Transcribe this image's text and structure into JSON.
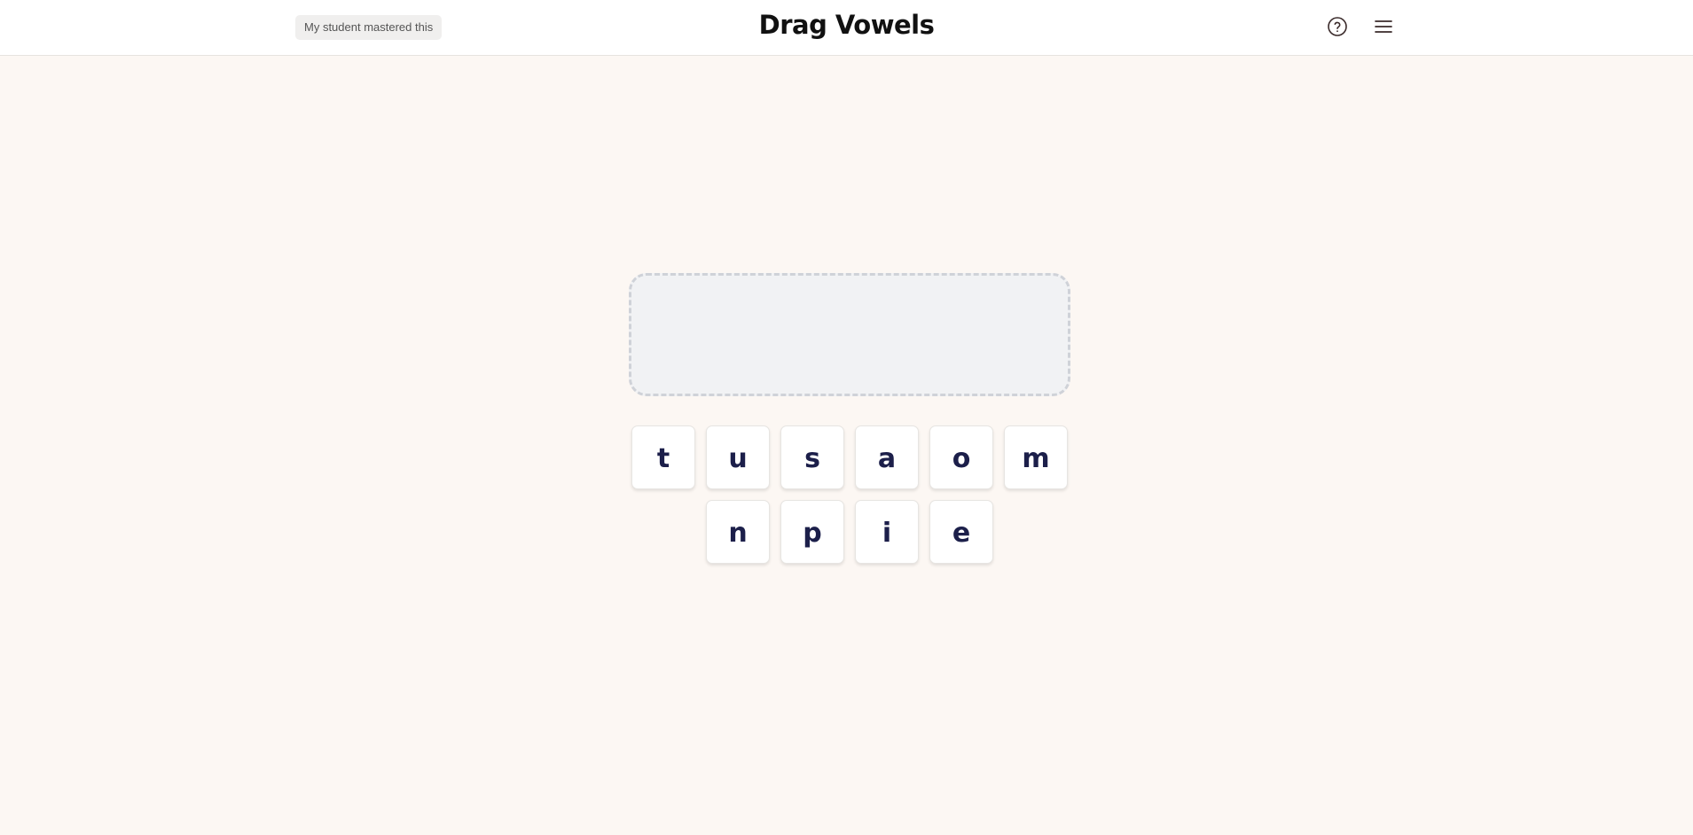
{
  "header": {
    "mastered_label": "My student mastered this",
    "title": "Drag Vowels",
    "help_icon": "help-circle-icon",
    "menu_icon": "hamburger-menu-icon"
  },
  "game": {
    "tiles_row1": [
      "t",
      "u",
      "s",
      "a",
      "o",
      "m"
    ],
    "tiles_row2": [
      "n",
      "p",
      "i",
      "e"
    ]
  },
  "colors": {
    "background": "#fcf7f3",
    "tile_text": "#1c1f4a",
    "drop_zone_fill": "#f1f2f4",
    "drop_zone_border": "#cfd2d8"
  }
}
